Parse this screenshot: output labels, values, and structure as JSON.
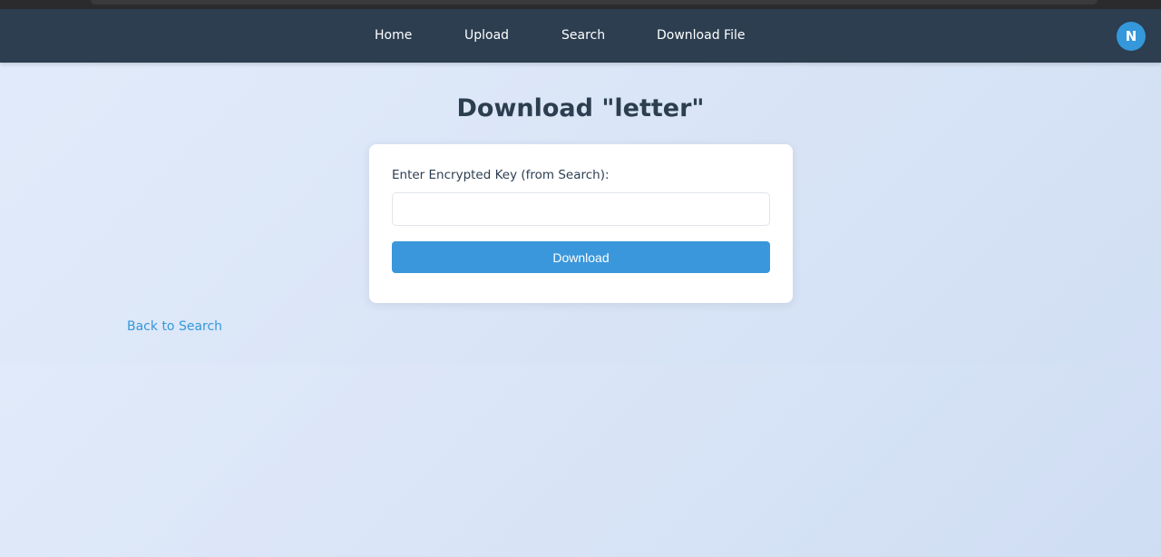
{
  "nav": {
    "items": [
      {
        "label": "Home"
      },
      {
        "label": "Upload"
      },
      {
        "label": "Search"
      },
      {
        "label": "Download File"
      }
    ],
    "avatar_initial": "N"
  },
  "main": {
    "title": "Download \"letter\"",
    "form": {
      "key_label": "Enter Encrypted Key (from Search):",
      "key_value": "",
      "key_placeholder": "",
      "submit_label": "Download"
    },
    "back_link": "Back to Search"
  },
  "colors": {
    "navbar": "#2c3e50",
    "accent": "#3498db",
    "title": "#2c3e50",
    "background": "#dde7f8"
  }
}
